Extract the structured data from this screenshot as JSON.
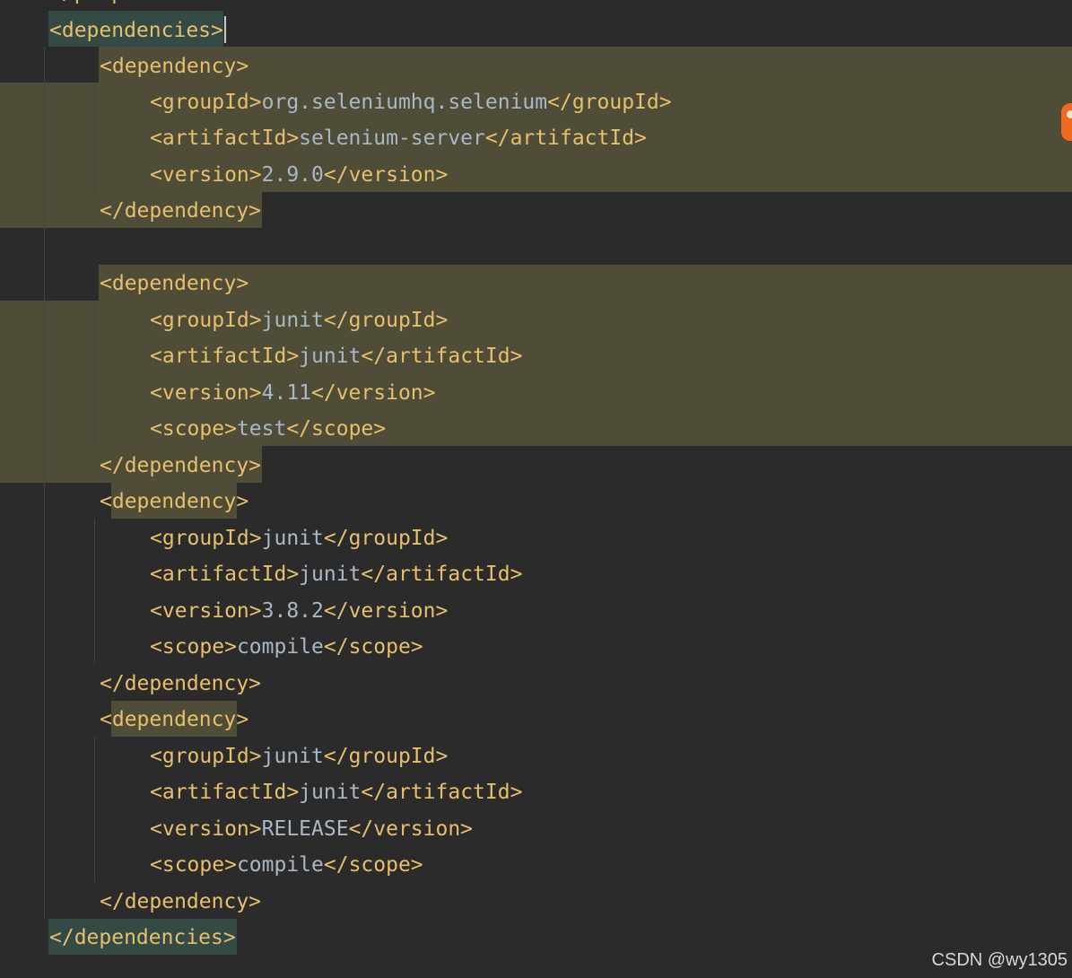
{
  "editor": {
    "top_partial_line": "</properties>",
    "lines": [
      {
        "open": "<dependencies>",
        "value": "",
        "close": ""
      },
      {
        "open": "<dependency>",
        "value": "",
        "close": ""
      },
      {
        "open": "<groupId>",
        "value": "org.seleniumhq.selenium",
        "close": "</groupId>"
      },
      {
        "open": "<artifactId>",
        "value": "selenium-server",
        "close": "</artifactId>"
      },
      {
        "open": "<version>",
        "value": "2.9.0",
        "close": "</version>"
      },
      {
        "open": "</dependency>",
        "value": "",
        "close": ""
      },
      {
        "open": "",
        "value": "",
        "close": ""
      },
      {
        "open": "<dependency>",
        "value": "",
        "close": ""
      },
      {
        "open": "<groupId>",
        "value": "junit",
        "close": "</groupId>"
      },
      {
        "open": "<artifactId>",
        "value": "junit",
        "close": "</artifactId>"
      },
      {
        "open": "<version>",
        "value": "4.11",
        "close": "</version>"
      },
      {
        "open": "<scope>",
        "value": "test",
        "close": "</scope>"
      },
      {
        "open": "</dependency>",
        "value": "",
        "close": ""
      },
      {
        "open": "<",
        "value": "dependency",
        "close": ">"
      },
      {
        "open": "<groupId>",
        "value": "junit",
        "close": "</groupId>"
      },
      {
        "open": "<artifactId>",
        "value": "junit",
        "close": "</artifactId>"
      },
      {
        "open": "<version>",
        "value": "3.8.2",
        "close": "</version>"
      },
      {
        "open": "<scope>",
        "value": "compile",
        "close": "</scope>"
      },
      {
        "open": "</dependency>",
        "value": "",
        "close": ""
      },
      {
        "open": "<",
        "value": "dependency",
        "close": ">"
      },
      {
        "open": "<groupId>",
        "value": "junit",
        "close": "</groupId>"
      },
      {
        "open": "<artifactId>",
        "value": "junit",
        "close": "</artifactId>"
      },
      {
        "open": "<version>",
        "value": "RELEASE",
        "close": "</version>"
      },
      {
        "open": "<scope>",
        "value": "compile",
        "close": "</scope>"
      },
      {
        "open": "</dependency>",
        "value": "",
        "close": ""
      },
      {
        "open": "</dependencies>",
        "value": "",
        "close": ""
      }
    ]
  },
  "colors": {
    "background": "#2b2b2b",
    "tag": "#e8bf6a",
    "value": "#a9b7c6",
    "highlight_olive": "#4f4d38",
    "highlight_green": "#344a44",
    "indent_guide": "#434343"
  },
  "watermark": "CSDN @wy1305"
}
